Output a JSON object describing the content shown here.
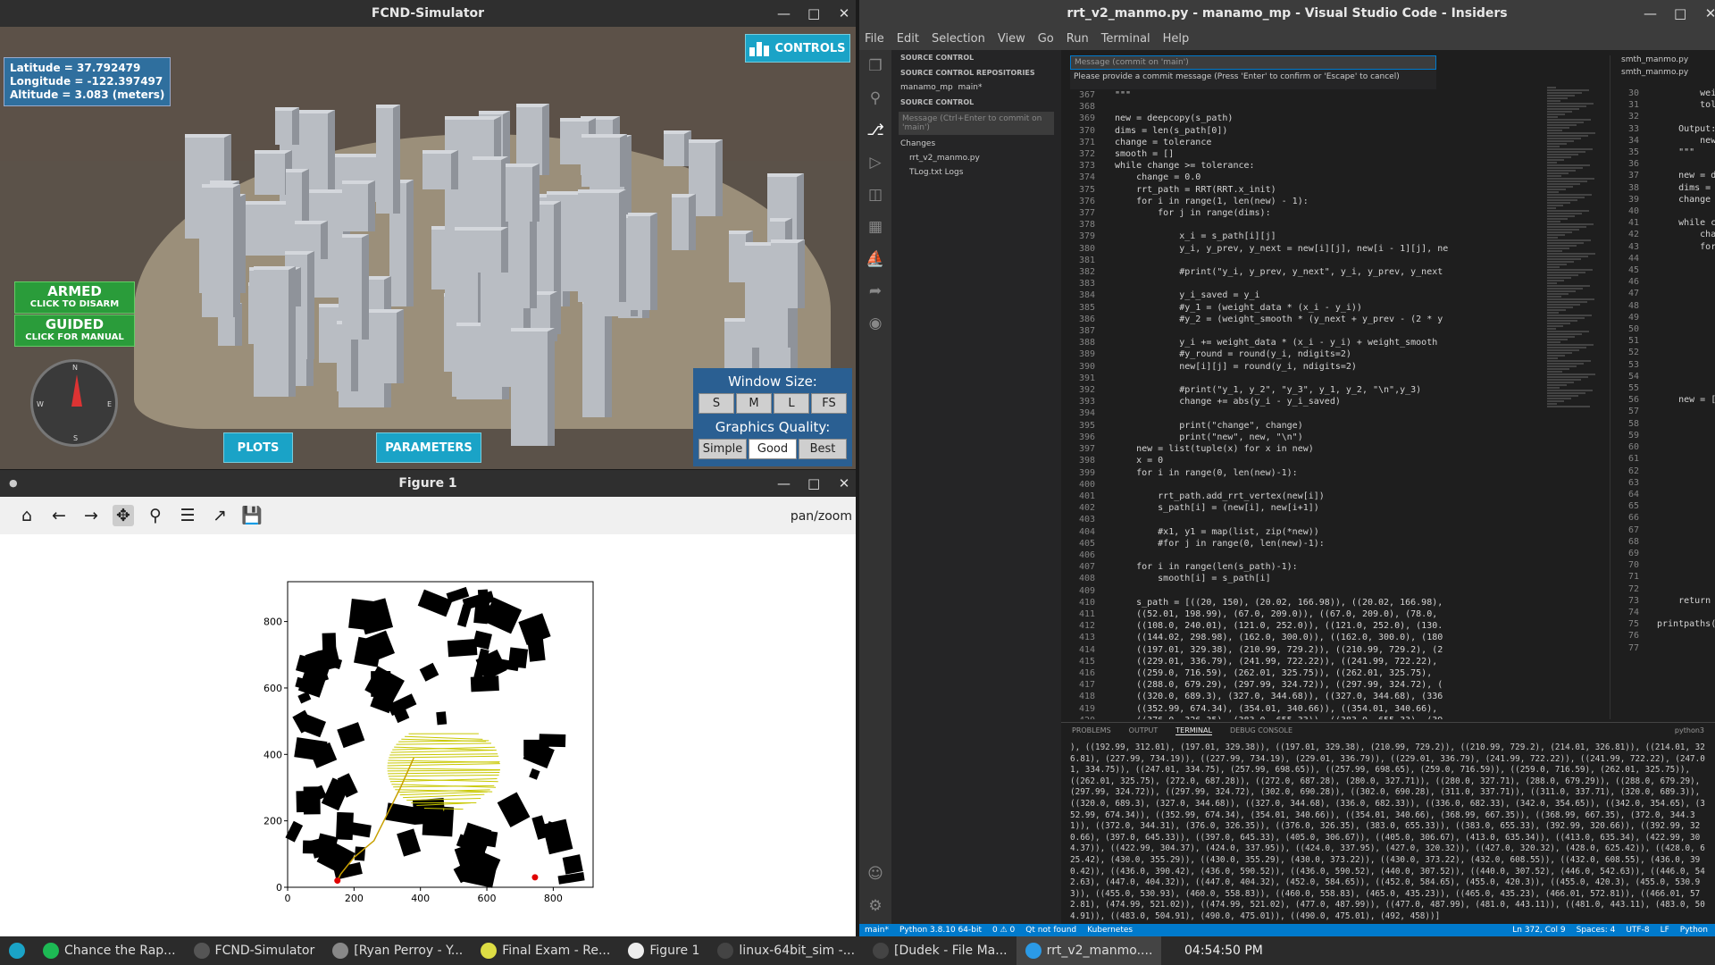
{
  "sim": {
    "title": "FCND-Simulator",
    "latitude": "Latitude = 37.792479",
    "longitude": "Longitude = -122.397497",
    "altitude": "Altitude = 3.083 (meters)",
    "controls_label": "CONTROLS",
    "armed_big": "ARMED",
    "armed_small": "CLICK TO DISARM",
    "guided_big": "GUIDED",
    "guided_small": "CLICK FOR MANUAL",
    "compass": {
      "n": "N",
      "s": "S",
      "w": "W",
      "e": "E"
    },
    "plots_label": "PLOTS",
    "parameters_label": "PARAMETERS",
    "window_size_label": "Window Size:",
    "window_sizes": [
      "S",
      "M",
      "L",
      "FS"
    ],
    "graphics_label": "Graphics Quality:",
    "graphics_opts": [
      "Simple",
      "Good",
      "Best"
    ],
    "graphics_selected": "Good"
  },
  "figure": {
    "title": "Figure 1",
    "mode": "pan/zoom",
    "toolbar_icons": [
      "home-icon",
      "back-icon",
      "forward-icon",
      "pan-icon",
      "zoom-icon",
      "configure-icon",
      "edit-curve-icon",
      "save-icon"
    ]
  },
  "chart_data": {
    "type": "scatter",
    "title": "",
    "xlabel": "",
    "ylabel": "",
    "xlim": [
      0,
      920
    ],
    "ylim": [
      0,
      920
    ],
    "xticks": [
      0,
      200,
      400,
      600,
      800
    ],
    "yticks": [
      0,
      200,
      400,
      600,
      800
    ],
    "series": [
      {
        "x": [
          150,
          160,
          200,
          260,
          300,
          340,
          380
        ],
        "y": [
          20,
          40,
          90,
          140,
          220,
          300,
          390
        ]
      }
    ],
    "points": [
      {
        "x": 150,
        "y": 20
      },
      {
        "x": 745,
        "y": 30
      }
    ],
    "colors": {
      "obstacle": "#000000",
      "tree": "#c8c800",
      "path": "#c8a000",
      "goal": "#e00000"
    }
  },
  "vscode": {
    "title": "rrt_v2_manmo.py - manamo_mp - Visual Studio Code - Insiders",
    "menu": [
      "File",
      "Edit",
      "Selection",
      "View",
      "Go",
      "Run",
      "Terminal",
      "Help"
    ],
    "commit_placeholder": "Message (commit on 'main')",
    "commit_hint": "Please provide a commit message (Press 'Enter' to confirm or 'Escape' to cancel)",
    "side_header": "SOURCE CONTROL",
    "repos_header": "SOURCE CONTROL REPOSITORIES",
    "repo_name": "manamo_mp",
    "repo_branch": "main*",
    "sc_header": "SOURCE CONTROL",
    "sc_msg": "Message (Ctrl+Enter to commit on 'main')",
    "changes": "Changes",
    "file1": "rrt_v2_manmo.py",
    "file2": "TLog.txt Logs",
    "line_start": 367,
    "lines": [
      "\"\"\"",
      "",
      "new = deepcopy(s_path)",
      "dims = len(s_path[0])",
      "change = tolerance",
      "smooth = []",
      "while change >= tolerance:",
      "    change = 0.0",
      "    rrt_path = RRT(RRT.x_init)",
      "    for i in range(1, len(new) - 1):",
      "        for j in range(dims):",
      "",
      "            x_i = s_path[i][j]",
      "            y_i, y_prev, y_next = new[i][j], new[i - 1][j], ne",
      "",
      "            #print(\"y_i, y_prev, y_next\", y_i, y_prev, y_next",
      "",
      "            y_i_saved = y_i",
      "            #y_1 = (weight_data * (x_i - y_i))",
      "            #y_2 = (weight_smooth * (y_next + y_prev - (2 * y",
      "",
      "            y_i += weight_data * (x_i - y_i) + weight_smooth",
      "            #y_round = round(y_i, ndigits=2)",
      "            new[i][j] = round(y_i, ndigits=2)",
      "",
      "            #print(\"y_1, y_2\", \"y_3\", y_1, y_2, \"\\n\",y_3)",
      "            change += abs(y_i - y_i_saved)",
      "",
      "            print(\"change\", change)",
      "            print(\"new\", new, \"\\n\")",
      "    new = list(tuple(x) for x in new)",
      "    x = 0",
      "    for i in range(0, len(new)-1):",
      "",
      "        rrt_path.add_rrt_vertex(new[i])",
      "        s_path[i] = (new[i], new[i+1])",
      "",
      "        #x1, y1 = map(list, zip(*new))",
      "        #for j in range(0, len(new)-1):",
      "",
      "    for i in range(len(s_path)-1):",
      "        smooth[i] = s_path[i]",
      "",
      "    s_path = [((20, 150), (20.02, 166.98)), ((20.02, 166.98),",
      "    ((52.01, 198.99), (67.0, 209.0)), ((67.0, 209.0), (78.0,",
      "    ((108.0, 240.01), (121.0, 252.0)), ((121.0, 252.0), (130.",
      "    ((144.02, 298.98), (162.0, 300.0)), ((162.0, 300.0), (180",
      "    ((197.01, 329.38), (210.99, 729.2)), ((210.99, 729.2), (2",
      "    ((229.01, 336.79), (241.99, 722.22)), ((241.99, 722.22),",
      "    ((259.0, 716.59), (262.01, 325.75)), ((262.01, 325.75),",
      "    ((288.0, 679.29), (297.99, 324.72)), ((297.99, 324.72), (",
      "    ((320.0, 689.3), (327.0, 344.68)), ((327.0, 344.68), (336",
      "    ((352.99, 674.34), (354.01, 340.66)), ((354.01, 340.66),",
      "    ((376.0, 326.35), (383.0, 655.33)), ((383.0, 655.33), (39"
    ],
    "ed2_tabs": "smth_manmo.py",
    "ed2_crumb": "smth_manmo.py",
    "ed2_line_start": 30,
    "ed2_lines": [
      "        weigh",
      "        toler",
      "",
      "    Output:",
      "        new:",
      "    \"\"\"",
      "",
      "    new = dee",
      "    dims = le",
      "    change =",
      "",
      "    while cha",
      "        chang",
      "        for i",
      "            f",
      "",
      "",
      "",
      "",
      "",
      "",
      "",
      "",
      "",
      "",
      "",
      "    new = [((",
      "            ((",
      "            ((",
      "            ((",
      "            ((",
      "            ((",
      "            ((",
      "            ((",
      "            ((",
      "            ((",
      "            ((",
      "            ((",
      "            ((",
      "            ((",
      "            ((",
      "",
      "",
      "    return ne",
      "",
      "printpaths(pa",
      "",
      ""
    ],
    "panel_tabs": [
      "PROBLEMS",
      "OUTPUT",
      "TERMINAL",
      "DEBUG CONSOLE"
    ],
    "panel_active": "TERMINAL",
    "terminal_shell": "python3",
    "terminal": "), ((192.99, 312.01), (197.01, 329.38)), ((197.01, 329.38), (210.99, 729.2)), ((210.99, 729.2), (214.01, 326.81)), ((214.01, 326.81), (227.99, 734.19)), ((227.99, 734.19), (229.01, 336.79)), ((229.01, 336.79), (241.99, 722.22)), ((241.99, 722.22), (247.01, 334.75)), ((247.01, 334.75), (257.99, 698.65)), ((257.99, 698.65), (259.0, 716.59)), ((259.0, 716.59), (262.01, 325.75)), ((262.01, 325.75), (272.0, 687.28)), ((272.0, 687.28), (280.0, 327.71)), ((280.0, 327.71), (288.0, 679.29)), ((288.0, 679.29), (297.99, 324.72)), ((297.99, 324.72), (302.0, 690.28)), ((302.0, 690.28), (311.0, 337.71)), ((311.0, 337.71), (320.0, 689.3)), ((320.0, 689.3), (327.0, 344.68)), ((327.0, 344.68), (336.0, 682.33)), ((336.0, 682.33), (342.0, 354.65)), ((342.0, 354.65), (352.99, 674.34)), ((352.99, 674.34), (354.01, 340.66)), ((354.01, 340.66), (368.99, 667.35)), ((368.99, 667.35), (372.0, 344.31)), ((372.0, 344.31), (376.0, 326.35)), ((376.0, 326.35), (383.0, 655.33)), ((383.0, 655.33), (392.99, 320.66)), ((392.99, 320.66), (397.0, 645.33)), ((397.0, 645.33), (405.0, 306.67)), ((405.0, 306.67), (413.0, 635.34)), ((413.0, 635.34), (422.99, 304.37)), ((422.99, 304.37), (424.0, 337.95)), ((424.0, 337.95), (427.0, 320.32)), ((427.0, 320.32), (428.0, 625.42)), ((428.0, 625.42), (430.0, 355.29)), ((430.0, 355.29), (430.0, 373.22)), ((430.0, 373.22), (432.0, 608.55)), ((432.0, 608.55), (436.0, 390.42)), ((436.0, 390.42), (436.0, 590.52)), ((436.0, 590.52), (440.0, 307.52)), ((440.0, 307.52), (446.0, 542.63)), ((446.0, 542.63), (447.0, 404.32)), ((447.0, 404.32), (452.0, 584.65)), ((452.0, 584.65), (455.0, 420.3)), ((455.0, 420.3), (455.0, 530.93)), ((455.0, 530.93), (460.0, 558.83)), ((460.0, 558.83), (465.0, 435.23)), ((465.0, 435.23), (466.01, 572.81)), ((466.01, 572.81), (474.99, 521.02)), ((474.99, 521.02), (477.0, 487.99)), ((477.0, 487.99), (481.0, 443.11)), ((481.0, 443.11), (483.0, 504.91)), ((483.0, 504.91), (490.0, 475.01)), ((490.0, 475.01), (492, 458))]",
    "status": {
      "branch": "main*",
      "python": "Python 3.8.10 64-bit",
      "errors": "0 ⚠ 0",
      "qt": "Qt not found",
      "k8s": "Kubernetes",
      "pos": "Ln 372, Col 9",
      "spaces": "Spaces: 4",
      "enc": "UTF-8",
      "eol": "LF",
      "lang": "Python"
    }
  },
  "taskbar": {
    "items": [
      "Chance the Rap...",
      "FCND-Simulator",
      "[Ryan Perroy - Y...",
      "Final Exam - Re...",
      "Figure 1",
      "linux-64bit_sim -...",
      "[Dudek - File Ma...",
      "rrt_v2_manmo...."
    ],
    "clock": "04:54:50 PM"
  }
}
